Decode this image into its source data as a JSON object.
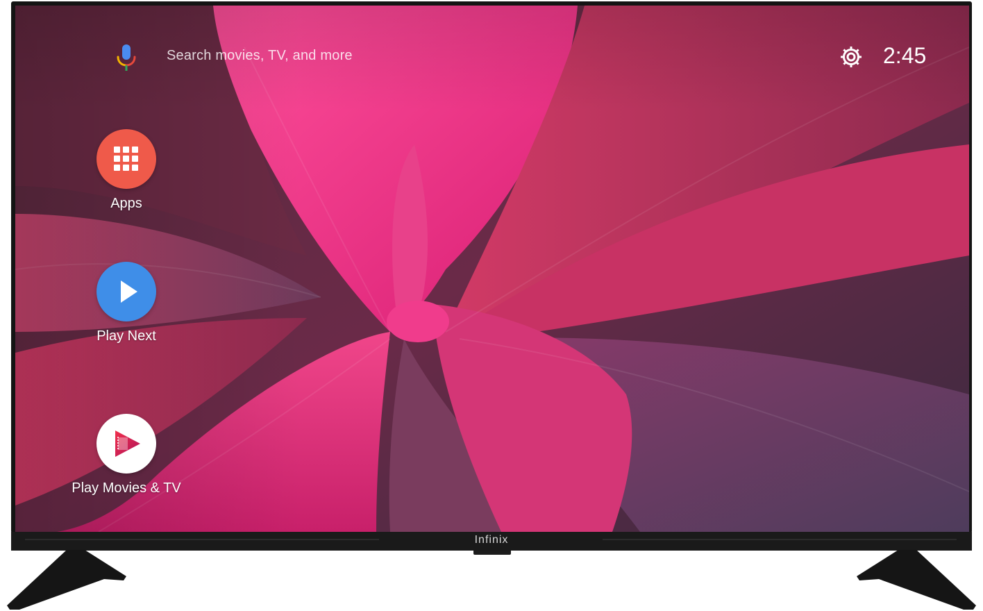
{
  "search": {
    "placeholder": "Search movies, TV, and more",
    "icon": "mic-icon"
  },
  "status": {
    "time": "2:45",
    "settings_icon": "gear-icon"
  },
  "nav": {
    "items": [
      {
        "label": "Apps",
        "icon": "apps-grid-icon",
        "color": "#ef5a4a"
      },
      {
        "label": "Play Next",
        "icon": "play-icon",
        "color": "#3f8ee8"
      },
      {
        "label": "Play Movies & TV",
        "icon": "play-movies-icon",
        "color": "#ffffff"
      }
    ]
  },
  "tv": {
    "brand": "Infinix",
    "bezel_color": "#141414"
  },
  "colors": {
    "wallpaper_pink": "#e8357a",
    "wallpaper_dark": "#4a3550"
  }
}
